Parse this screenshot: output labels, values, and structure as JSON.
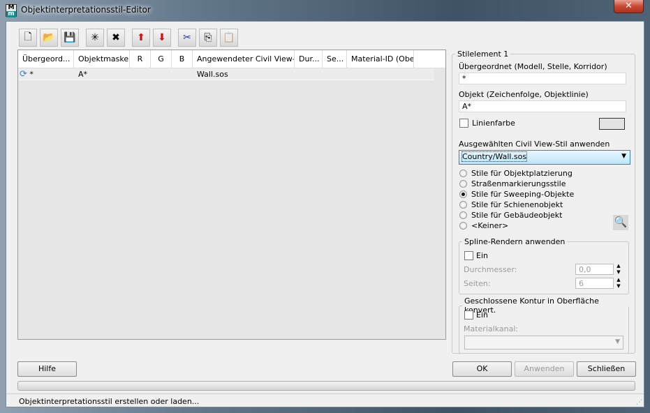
{
  "window": {
    "title": "Objektinterpretationsstil-Editor",
    "close": "✕",
    "icon_text_top": "M",
    "icon_text_bottom": "m"
  },
  "toolbar": [
    {
      "name": "new-icon",
      "glyph": "🗋"
    },
    {
      "name": "open-icon",
      "glyph": "📂"
    },
    {
      "name": "save-icon",
      "glyph": "💾"
    },
    {
      "name": "add-element-icon",
      "glyph": "✳"
    },
    {
      "name": "delete-element-icon",
      "glyph": "✖"
    },
    {
      "name": "move-up-icon",
      "glyph": "⬆"
    },
    {
      "name": "move-down-icon",
      "glyph": "⬇"
    },
    {
      "name": "cut-icon",
      "glyph": "✂"
    },
    {
      "name": "copy-icon",
      "glyph": "⎘"
    },
    {
      "name": "paste-icon",
      "glyph": "📋"
    }
  ],
  "grid": {
    "columns": [
      "Übergeord...",
      "Objektmaske",
      "R",
      "G",
      "B",
      "Angewendeter Civil View-Stil",
      "Dur...",
      "Se...",
      "Material-ID (Oberfl..."
    ],
    "rows": [
      {
        "parent": "*",
        "mask": "A*",
        "r": "",
        "g": "",
        "b": "",
        "style": "Wall.sos"
      }
    ]
  },
  "panel": {
    "legend": "Stilelement 1",
    "parent_label": "Übergeordnet (Modell, Stelle, Korridor)",
    "parent_value": "*",
    "object_label": "Objekt (Zeichenfolge, Objektlinie)",
    "object_value": "A*",
    "linecolor_label": "Linienfarbe",
    "linecolor_checked": false,
    "linecolor_swatch": "#e3e3e3",
    "style_label": "Ausgewählten Civil View-Stil anwenden",
    "style_value": "Country/Wall.sos",
    "radios": [
      {
        "label": "Stile für Objektplatzierung",
        "checked": false
      },
      {
        "label": "Straßenmarkierungsstile",
        "checked": false
      },
      {
        "label": "Stile für Sweeping-Objekte",
        "checked": true
      },
      {
        "label": "Stile für Schienenobjekt",
        "checked": false
      },
      {
        "label": "Stile für Gebäudeobjekt",
        "checked": false
      },
      {
        "label": "<Keiner>",
        "checked": false
      }
    ],
    "spline": {
      "legend": "Spline-Rendern anwenden",
      "on_label": "Ein",
      "diameter_label": "Durchmesser:",
      "diameter_value": "0,0",
      "sides_label": "Seiten:",
      "sides_value": "6"
    },
    "closed": {
      "legend": "Geschlossene Kontur in Oberfläche konvert.",
      "on_label": "Ein",
      "channel_label": "Materialkanal:",
      "channel_value": ""
    }
  },
  "buttons": {
    "help": "Hilfe",
    "ok": "OK",
    "apply": "Anwenden",
    "close": "Schließen"
  },
  "status": "Objektinterpretationsstil erstellen oder laden..."
}
